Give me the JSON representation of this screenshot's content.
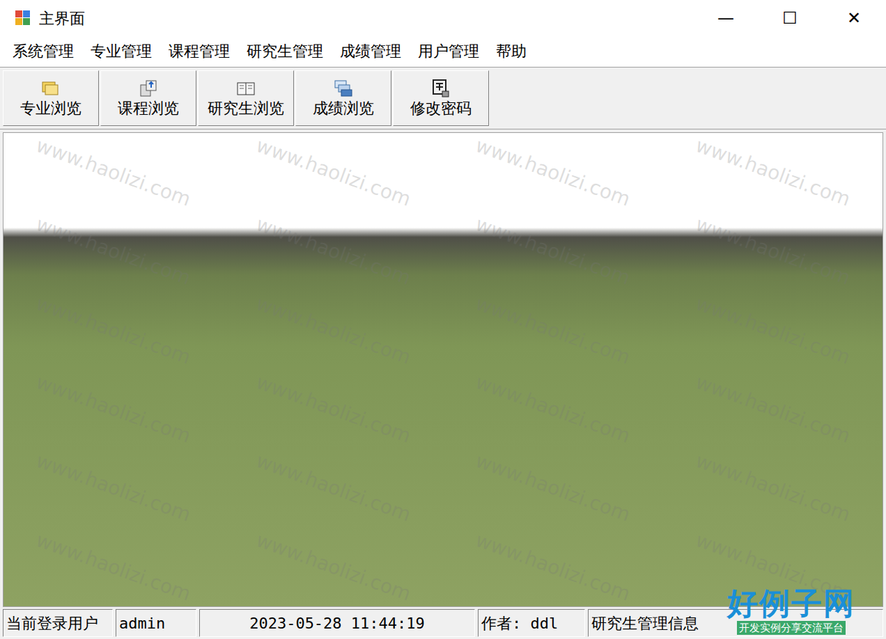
{
  "window": {
    "title": "主界面",
    "controls": [
      "—",
      "☐",
      "✕"
    ]
  },
  "menu": [
    {
      "label": "系统管理"
    },
    {
      "label": "专业管理"
    },
    {
      "label": "课程管理"
    },
    {
      "label": "研究生管理"
    },
    {
      "label": "成绩管理"
    },
    {
      "label": "用户管理"
    },
    {
      "label": "帮助"
    }
  ],
  "toolbar": [
    {
      "label": "专业浏览"
    },
    {
      "label": "课程浏览"
    },
    {
      "label": "研究生浏览"
    },
    {
      "label": "成绩浏览"
    },
    {
      "label": "修改密码"
    }
  ],
  "watermark": {
    "text": "www.haolizi.com"
  },
  "status_bar": [
    {
      "text": "当前登录用户"
    },
    {
      "text": "admin"
    },
    {
      "text": "2023-05-28 11:44:19"
    },
    {
      "text": "作者: ddl"
    },
    {
      "text": "研究生管理信息"
    }
  ],
  "logo": {
    "title": "好例子网",
    "subtitle": "开发实例分享交流平台"
  }
}
